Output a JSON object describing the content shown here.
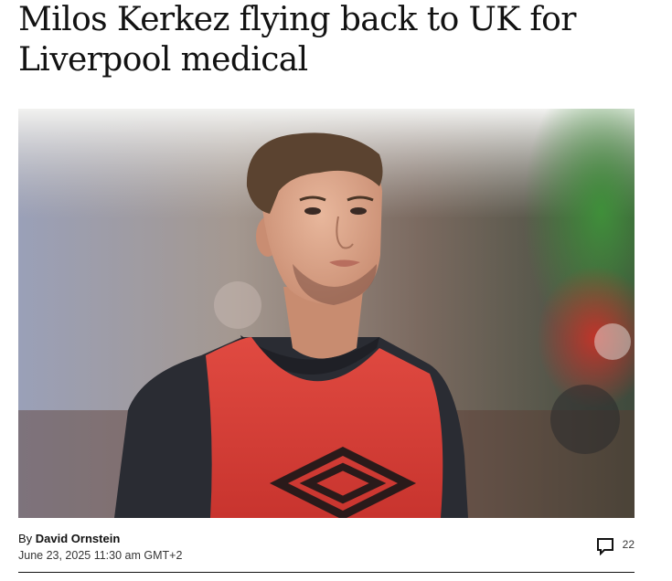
{
  "article": {
    "headline": "Milos Kerkez flying back to UK for Liverpool medical",
    "byline_prefix": "By",
    "author": "David Ornstein",
    "timestamp": "June 23, 2025 11:30 am GMT+2",
    "comment_count": "22"
  },
  "image": {
    "subject": "footballer-in-red-training-bib",
    "bib_color": "#d43a34",
    "shirt_color": "#2a2c33"
  },
  "icons": {
    "comments": "speech-bubble-icon"
  }
}
